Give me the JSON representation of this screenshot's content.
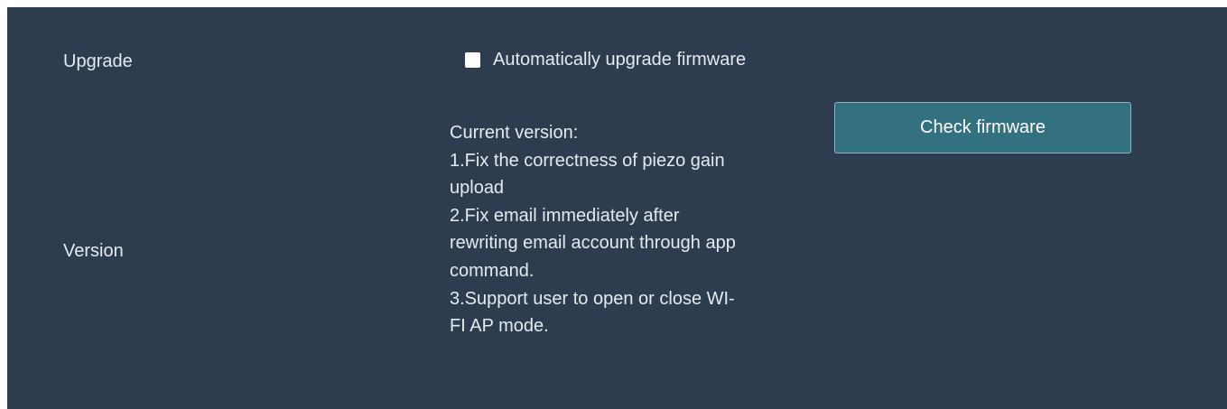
{
  "upgrade": {
    "label": "Upgrade",
    "auto_upgrade": {
      "label": "Automatically upgrade firmware",
      "checked": false
    }
  },
  "version": {
    "label": "Version",
    "notes": [
      "Current version:",
      "1.Fix the correctness of piezo gain",
      "upload",
      "2.Fix email immediately after",
      "rewriting email account through app",
      "command.",
      "3.Support user to open or close WI-",
      "FI AP mode."
    ],
    "check_button_label": "Check firmware"
  },
  "colors": {
    "panel_bg": "#2e3c4f",
    "text": "#e6eaee",
    "button_bg": "#347180"
  }
}
